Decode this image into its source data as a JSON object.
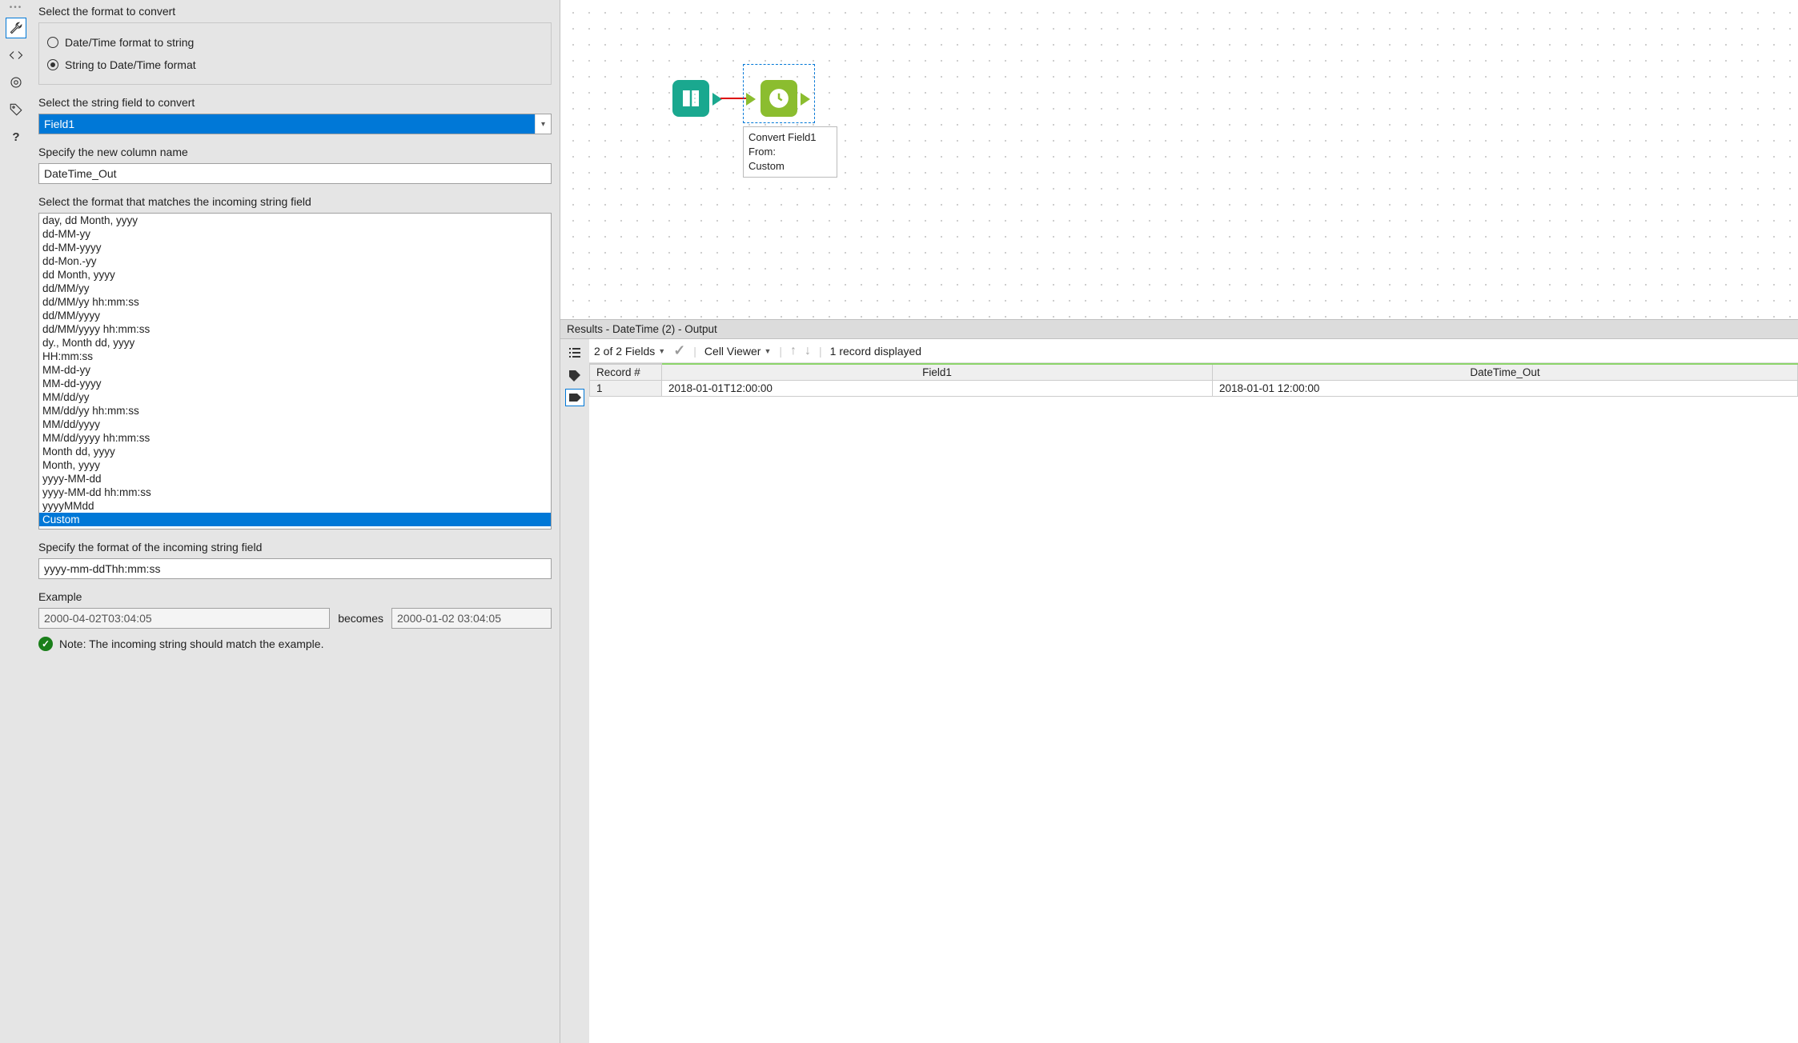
{
  "sidebar_tools": [
    "wrench",
    "code",
    "target",
    "tag",
    "help"
  ],
  "config": {
    "radio_title": "Select the format to convert",
    "radio_options": [
      {
        "label": "Date/Time format to string",
        "selected": false
      },
      {
        "label": "String to Date/Time format",
        "selected": true
      }
    ],
    "field_label": "Select the string field to convert",
    "field_value": "Field1",
    "newcol_label": "Specify the new column name",
    "newcol_value": "DateTime_Out",
    "format_list_label": "Select the format that matches the incoming string field",
    "format_items": [
      "day, dd Month, yyyy",
      "dd-MM-yy",
      "dd-MM-yyyy",
      "dd-Mon.-yy",
      "dd Month, yyyy",
      "dd/MM/yy",
      "dd/MM/yy hh:mm:ss",
      "dd/MM/yyyy",
      "dd/MM/yyyy hh:mm:ss",
      "dy., Month dd, yyyy",
      "HH:mm:ss",
      "MM-dd-yy",
      "MM-dd-yyyy",
      "MM/dd/yy",
      "MM/dd/yy hh:mm:ss",
      "MM/dd/yyyy",
      "MM/dd/yyyy hh:mm:ss",
      "Month dd, yyyy",
      "Month, yyyy",
      "yyyy-MM-dd",
      "yyyy-MM-dd hh:mm:ss",
      "yyyyMMdd",
      "Custom"
    ],
    "selected_format_index": 22,
    "custom_label": "Specify the format of the incoming string field",
    "custom_value": "yyyy-mm-ddThh:mm:ss",
    "example_label": "Example",
    "example_in": "2000-04-02T03:04:05",
    "becomes": "becomes",
    "example_out": "2000-01-02 03:04:05",
    "note": "Note: The incoming string should match the example."
  },
  "canvas": {
    "node_label_line1": "Convert Field1",
    "node_label_line2": "From:",
    "node_label_line3": "Custom"
  },
  "results": {
    "header": "Results - DateTime (2) - Output",
    "fields_summary": "2 of 2 Fields",
    "cell_viewer": "Cell Viewer",
    "record_count": "1 record displayed",
    "columns": [
      "Record #",
      "Field1",
      "DateTime_Out"
    ],
    "rows": [
      {
        "recnum": "1",
        "Field1": "2018-01-01T12:00:00",
        "DateTime_Out": "2018-01-01 12:00:00"
      }
    ]
  }
}
